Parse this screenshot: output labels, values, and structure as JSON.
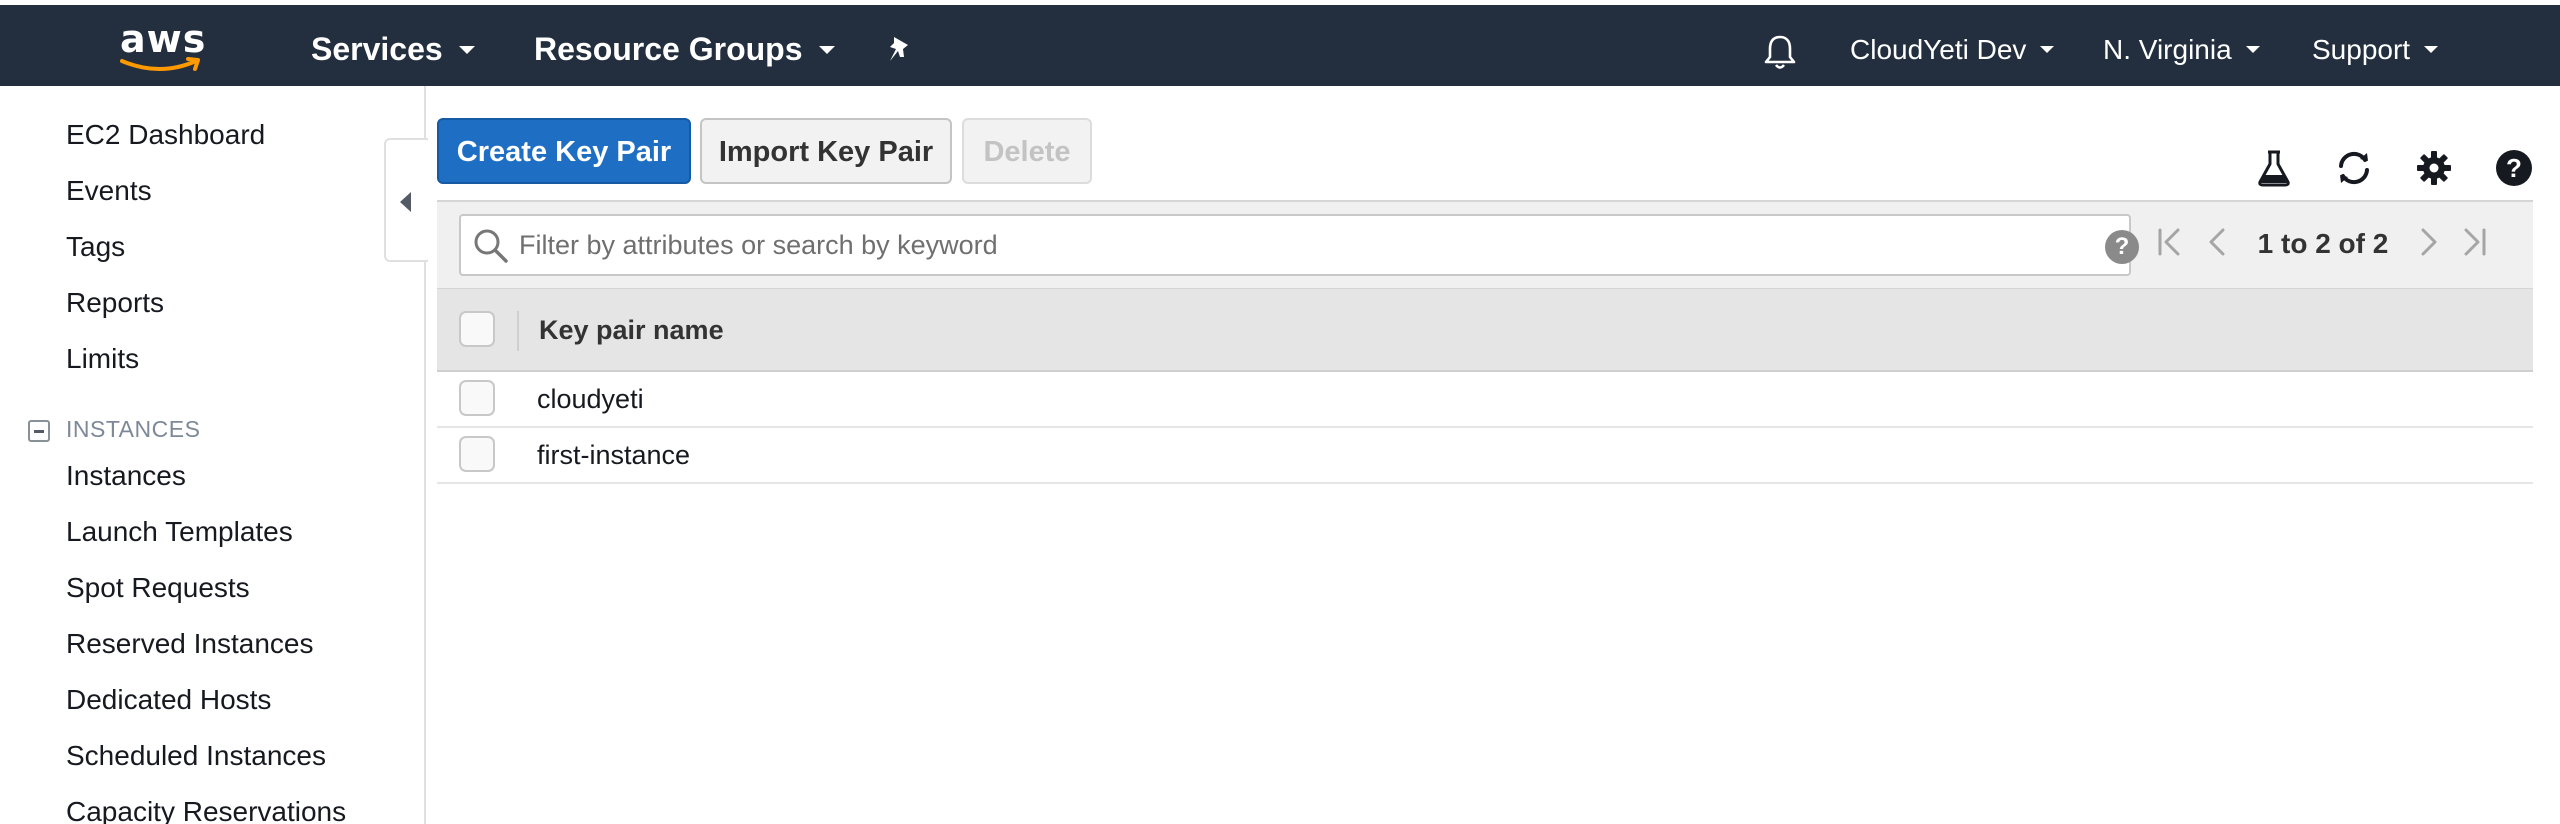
{
  "topbar": {
    "logo_text": "aws",
    "services": "Services",
    "resource_groups": "Resource Groups",
    "pin_icon": "pin-icon",
    "bell_icon": "bell-icon",
    "account": "CloudYeti Dev",
    "region": "N. Virginia",
    "support": "Support"
  },
  "sidebar": {
    "links_top": [
      "EC2 Dashboard",
      "Events",
      "Tags",
      "Reports",
      "Limits"
    ],
    "section_instances": "INSTANCES",
    "links_instances": [
      "Instances",
      "Launch Templates",
      "Spot Requests",
      "Reserved Instances",
      "Dedicated Hosts",
      "Scheduled Instances",
      "Capacity Reservations"
    ]
  },
  "toolbar": {
    "create_label": "Create Key Pair",
    "import_label": "Import Key Pair",
    "delete_label": "Delete",
    "icons": [
      "flask-icon",
      "refresh-icon",
      "gear-icon",
      "help-icon"
    ]
  },
  "filter": {
    "placeholder": "Filter by attributes or search by keyword",
    "help": "?"
  },
  "pager": {
    "text": "1 to 2 of 2"
  },
  "table": {
    "column": "Key pair name",
    "rows": [
      "cloudyeti",
      "first-instance"
    ]
  },
  "colors": {
    "nav_bg": "#232f3e",
    "primary": "#1e6fc3",
    "aws_orange": "#ff9900"
  }
}
